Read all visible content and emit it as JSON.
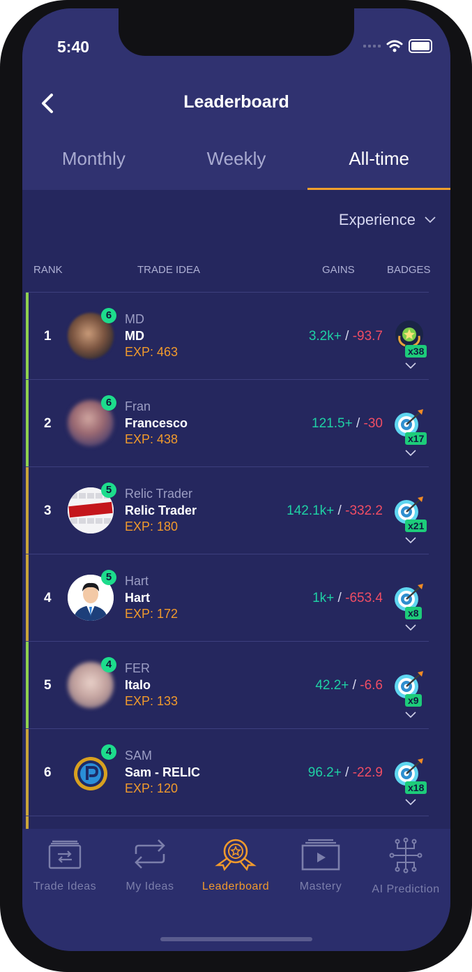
{
  "status": {
    "time": "5:40"
  },
  "header": {
    "title": "Leaderboard"
  },
  "tabs": [
    {
      "label": "Monthly",
      "active": false
    },
    {
      "label": "Weekly",
      "active": false
    },
    {
      "label": "All-time",
      "active": true
    }
  ],
  "sort": {
    "label": "Experience"
  },
  "columns": {
    "rank": "RANK",
    "trade_idea": "TRADE IDEA",
    "gains": "GAINS",
    "badges": "BADGES"
  },
  "colors": {
    "accent": "#f19a2c",
    "positive": "#1fd0a4",
    "negative": "#ef4d64",
    "level": "#1ddc8c"
  },
  "rows": [
    {
      "rank": "1",
      "level": "6",
      "username": "MD",
      "name": "MD",
      "exp": "EXP: 463",
      "gain_pos": "3.2k+",
      "gain_neg": "-93.7",
      "badge_count": "x38",
      "badge_icon": "star-trophy-badge-icon",
      "bar_color": "#8fd14f"
    },
    {
      "rank": "2",
      "level": "6",
      "username": "Fran",
      "name": "Francesco",
      "exp": "EXP: 438",
      "gain_pos": "121.5+",
      "gain_neg": "-30",
      "badge_count": "x17",
      "badge_icon": "target-badge-icon",
      "bar_color": "#8fd14f"
    },
    {
      "rank": "3",
      "level": "5",
      "username": "Relic Trader",
      "name": "Relic Trader",
      "exp": "EXP: 180",
      "gain_pos": "142.1k+",
      "gain_neg": "-332.2",
      "badge_count": "x21",
      "badge_icon": "target-badge-icon",
      "bar_color": "#c9a43a"
    },
    {
      "rank": "4",
      "level": "5",
      "username": "Hart",
      "name": "Hart",
      "exp": "EXP: 172",
      "gain_pos": "1k+",
      "gain_neg": "-653.4",
      "badge_count": "x8",
      "badge_icon": "target-badge-icon",
      "bar_color": "#c9a43a"
    },
    {
      "rank": "5",
      "level": "4",
      "username": "FER",
      "name": "Italo",
      "exp": "EXP: 133",
      "gain_pos": "42.2+",
      "gain_neg": "-6.6",
      "badge_count": "x9",
      "badge_icon": "target-badge-icon",
      "bar_color": "#8fd14f"
    },
    {
      "rank": "6",
      "level": "4",
      "username": "SAM",
      "name": "Sam - RELIC",
      "exp": "EXP: 120",
      "gain_pos": "96.2+",
      "gain_neg": "-22.9",
      "badge_count": "x18",
      "badge_icon": "target-badge-icon",
      "bar_color": "#c9a43a"
    }
  ],
  "bottom_nav": [
    {
      "label": "Trade Ideas",
      "icon": "trade-ideas-icon",
      "active": false
    },
    {
      "label": "My Ideas",
      "icon": "repeat-icon",
      "active": false
    },
    {
      "label": "Leaderboard",
      "icon": "medal-icon",
      "active": true
    },
    {
      "label": "Mastery",
      "icon": "video-icon",
      "active": false
    },
    {
      "label": "AI Prediction",
      "icon": "circuit-icon",
      "active": false
    }
  ]
}
